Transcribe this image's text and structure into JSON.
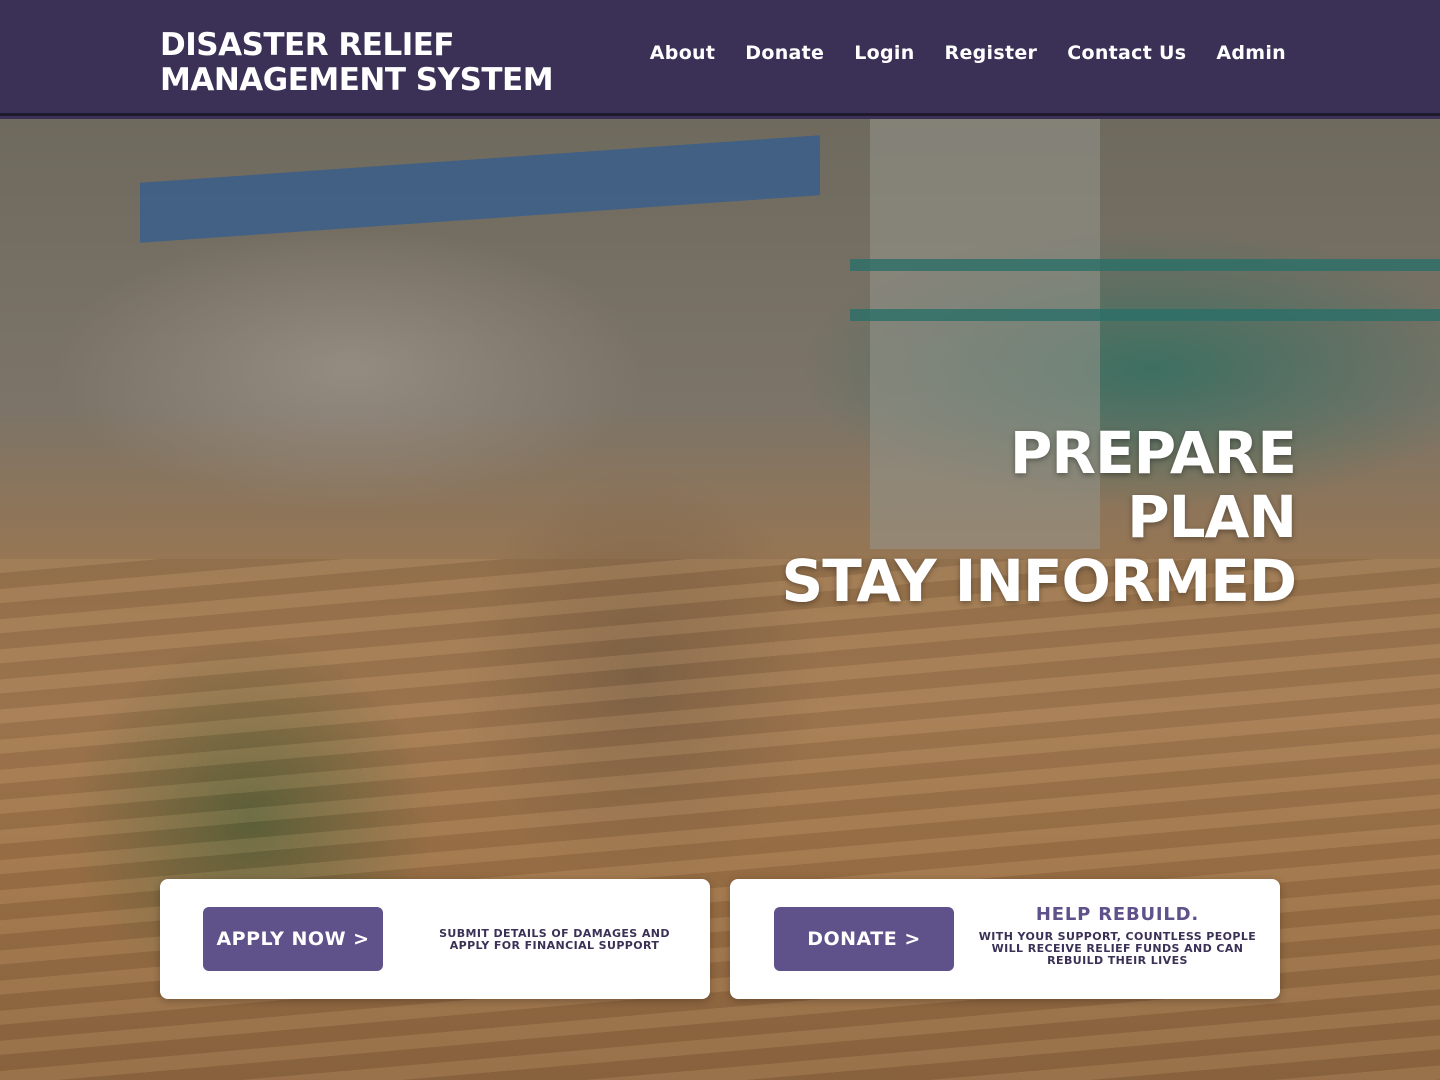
{
  "header": {
    "brand_line1": "DISASTER RELIEF",
    "brand_line2": "MANAGEMENT SYSTEM",
    "nav": [
      "About",
      "Donate",
      "Login",
      "Register",
      "Contact Us",
      "Admin"
    ]
  },
  "hero": {
    "tagline": [
      "PREPARE",
      "PLAN",
      "STAY INFORMED"
    ]
  },
  "cards": {
    "apply": {
      "button_label": "APPLY NOW >",
      "description": "SUBMIT DETAILS OF DAMAGES AND APPLY FOR FINANCIAL SUPPORT"
    },
    "donate": {
      "button_label": "DONATE >",
      "heading": "HELP REBUILD.",
      "description": "WITH YOUR SUPPORT, COUNTLESS PEOPLE WILL RECEIVE RELIEF FUNDS AND CAN REBUILD THEIR LIVES"
    }
  },
  "colors": {
    "header_bg": "#3b3156",
    "button_bg": "#5f5189",
    "card_bg": "#ffffff"
  }
}
